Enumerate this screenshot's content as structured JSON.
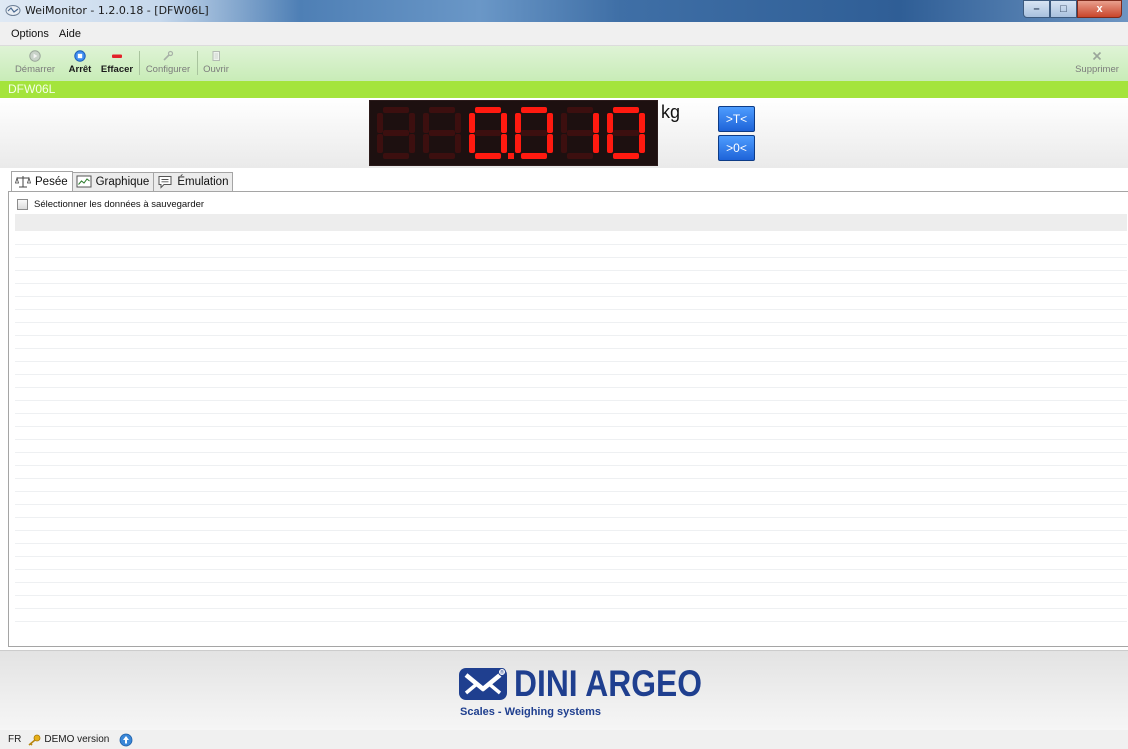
{
  "window": {
    "title": "WeiMonitor - 1.2.0.18 - [DFW06L]",
    "controls": {
      "minimize": "–",
      "maximize": "□",
      "close": "x"
    }
  },
  "menu": {
    "items": [
      "Options",
      "Aide"
    ]
  },
  "toolbar": {
    "start_label": "Démarrer",
    "stop_label": "Arrêt",
    "clear_label": "Effacer",
    "configure_label": "Configurer",
    "open_label": "Ouvrir",
    "delete_label": "Supprimer"
  },
  "device": {
    "name": "DFW06L"
  },
  "display": {
    "weight": "0.010",
    "unit": "kg",
    "tare_button": ">T<",
    "zero_button": ">0<",
    "digit_color": "#ff1a10",
    "dim_color": "#3c0f0f"
  },
  "tabs": [
    {
      "label": "Pesée",
      "active": true
    },
    {
      "label": "Graphique",
      "active": false
    },
    {
      "label": "Émulation",
      "active": false
    }
  ],
  "weighing": {
    "select_data_label": "Sélectionner les données à sauvegarder",
    "select_data_checked": false
  },
  "footer": {
    "brand": "DINI ARGEO",
    "tagline": "Scales - Weighing systems",
    "brand_color": "#1f3f8f"
  },
  "status": {
    "language": "FR",
    "license": "DEMO version"
  },
  "colors": {
    "toolbar_green": "#c8ecb7",
    "device_bar": "#a4e43c",
    "button_blue": "#1e63d8"
  }
}
